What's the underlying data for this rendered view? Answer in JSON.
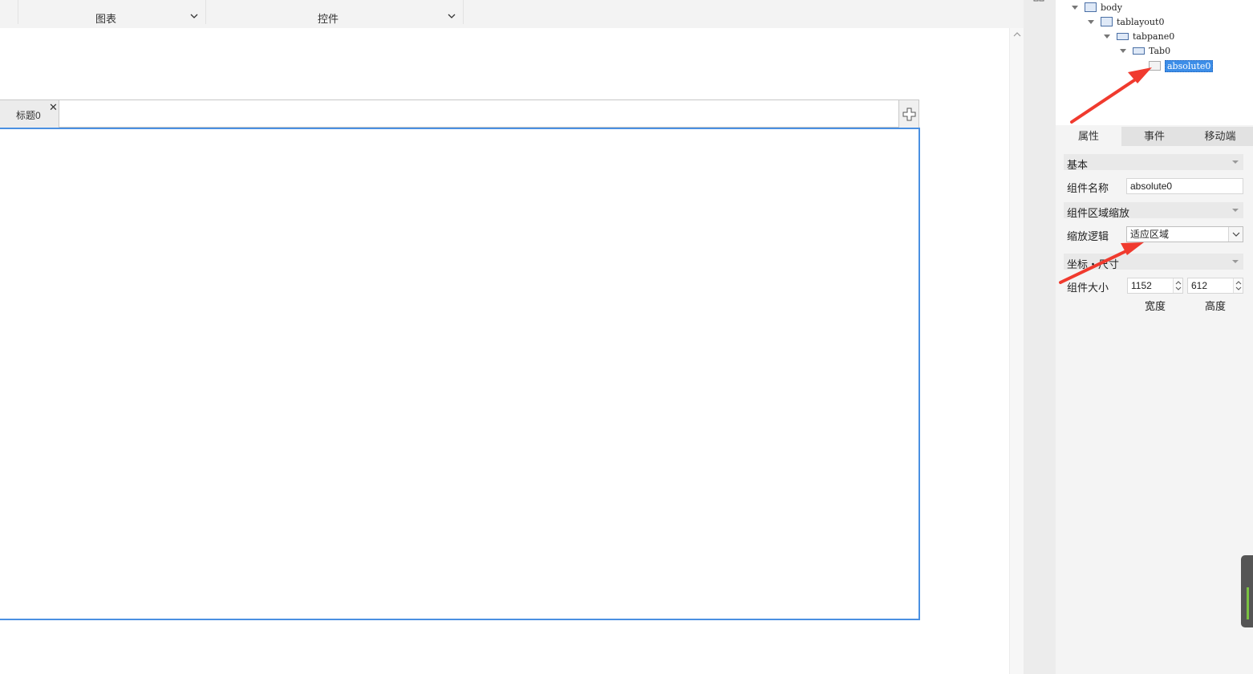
{
  "toolbar": {
    "groups": [
      {
        "label": "图表"
      },
      {
        "label": "控件"
      }
    ]
  },
  "tab_component": {
    "tab_title": "标题0",
    "close_glyph": "✕"
  },
  "tree": {
    "nodes": [
      {
        "label": "body",
        "icon": "body-icon"
      },
      {
        "label": "tablayout0",
        "icon": "tablayout-icon"
      },
      {
        "label": "tabpane0",
        "icon": "tabpane-icon"
      },
      {
        "label": "Tab0",
        "icon": "tab-icon"
      },
      {
        "label": "absolute0",
        "icon": "absolute-layout-icon",
        "selected": true
      }
    ]
  },
  "property_tabs": [
    "属性",
    "事件",
    "移动端"
  ],
  "properties": {
    "section_basic": "基本",
    "name_label": "组件名称",
    "name_value": "absolute0",
    "section_scale": "组件区域缩放",
    "scale_label": "缩放逻辑",
    "scale_value": "适应区域",
    "section_coords": "坐标・尺寸",
    "size_label": "组件大小",
    "width_value": "1152",
    "height_value": "612",
    "width_caption": "宽度",
    "height_caption": "高度"
  },
  "annotations": {
    "arrow_color": "#f03a2e"
  }
}
